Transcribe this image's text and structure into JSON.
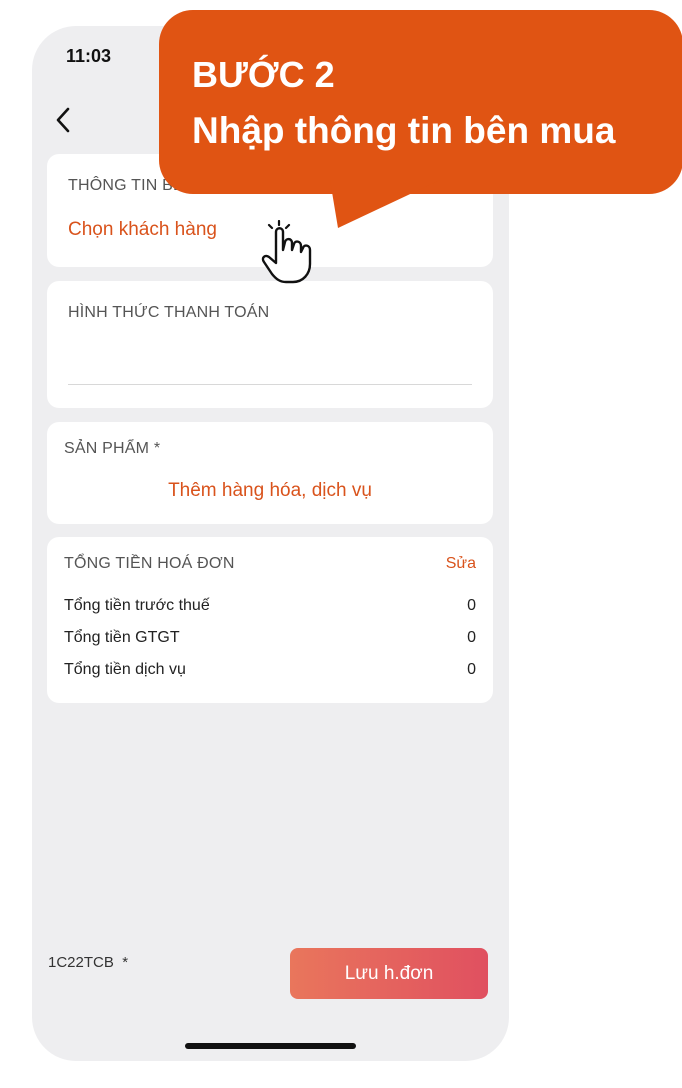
{
  "status_bar": {
    "time": "11:03"
  },
  "header": {
    "back_icon": "chevron-left-icon"
  },
  "buyer_section": {
    "label": "THÔNG TIN BÊN MUA",
    "action": "Chọn khách hàng"
  },
  "payment_section": {
    "label": "HÌNH THỨC THANH TOÁN",
    "value": ""
  },
  "products_section": {
    "label": "SẢN PHẨM *",
    "action": "Thêm hàng hóa, dịch vụ"
  },
  "totals_section": {
    "label": "TỔNG TIỀN HOÁ ĐƠN",
    "edit_label": "Sửa",
    "rows": [
      {
        "label": "Tổng tiền trước thuế",
        "value": "0"
      },
      {
        "label": "Tổng tiền GTGT",
        "value": "0"
      },
      {
        "label": "Tổng tiền dịch vụ",
        "value": "0"
      }
    ]
  },
  "footer": {
    "series": "1C22TCB  *",
    "save_label": "Lưu h.đơn"
  },
  "callout": {
    "title": "BƯỚC 2",
    "subtitle": "Nhập thông tin bên mua"
  },
  "colors": {
    "accent": "#d9531c",
    "callout": "#e05413",
    "background": "#eeeef0"
  }
}
